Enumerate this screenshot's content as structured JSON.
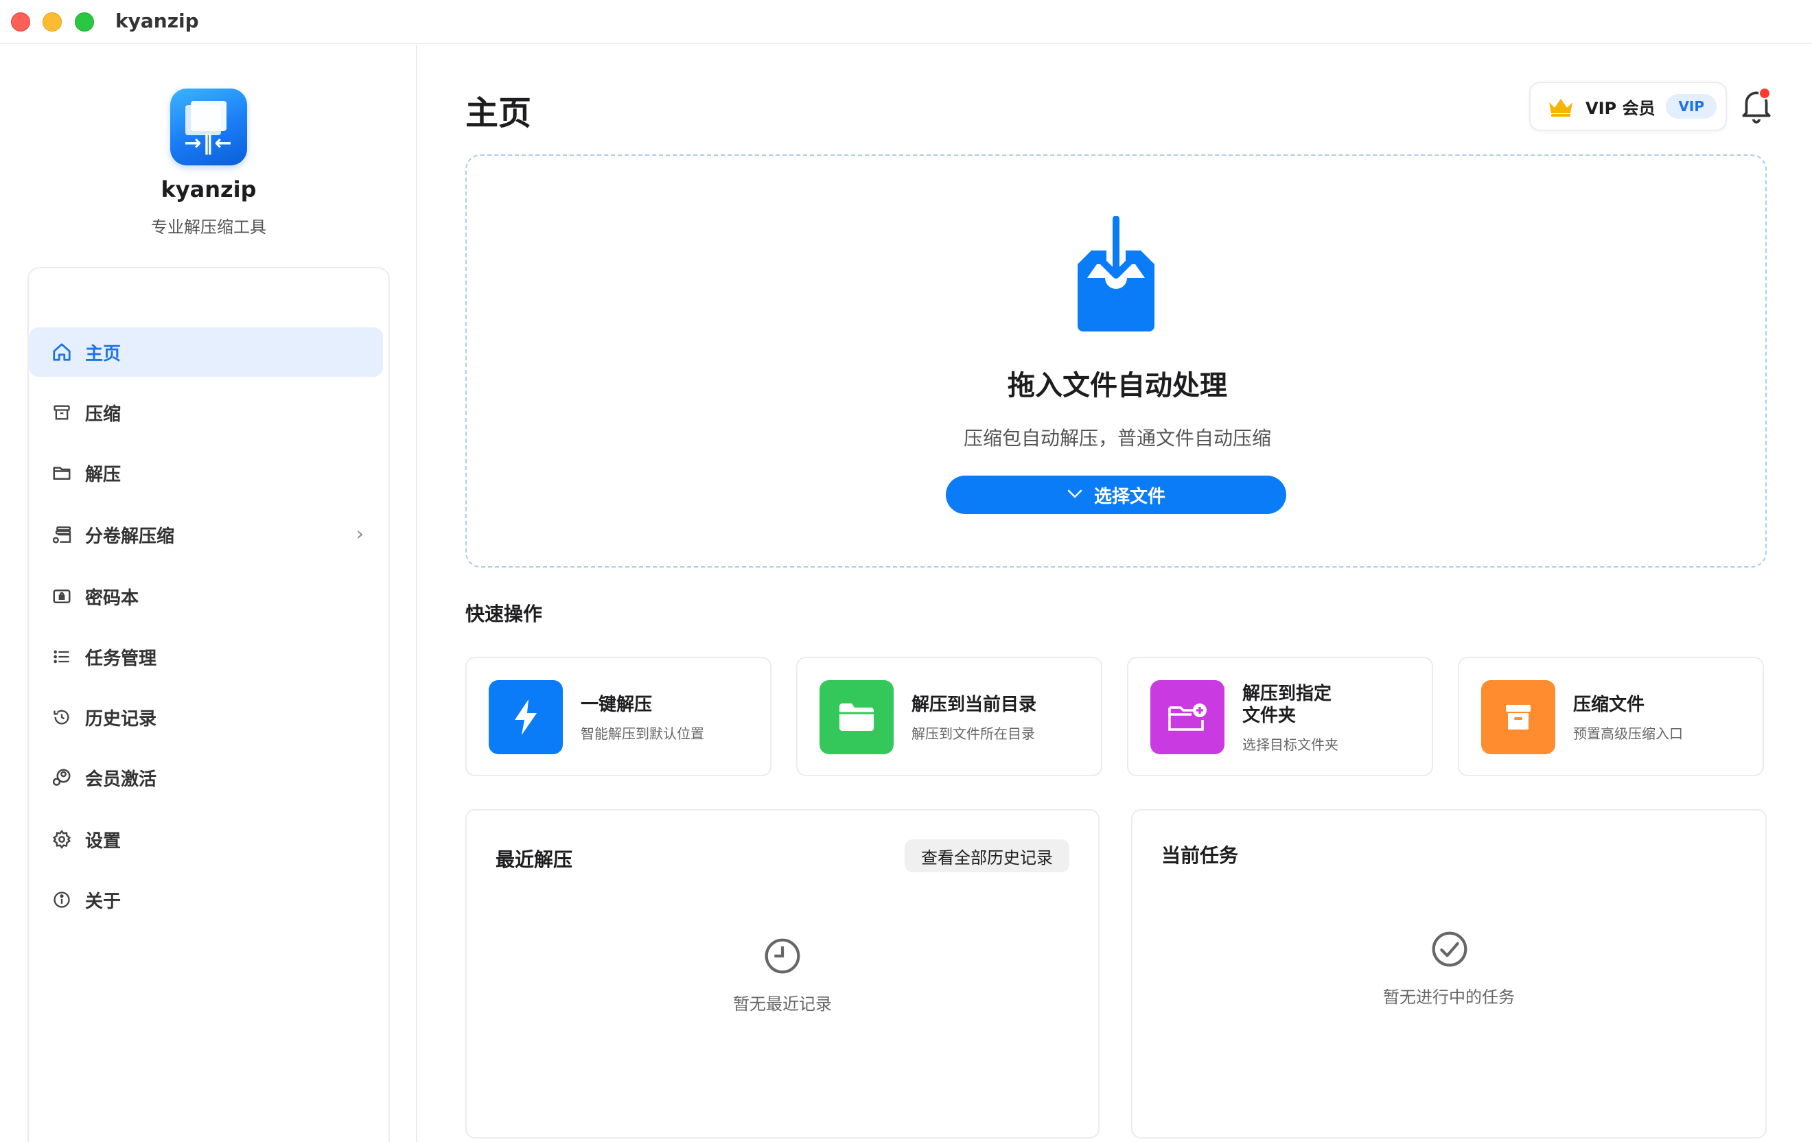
{
  "window": {
    "title": "kyanzip"
  },
  "sidebar": {
    "brand_name": "kyanzip",
    "brand_subtitle": "专业解压缩工具",
    "items": [
      {
        "label": "主页",
        "icon": "home-icon",
        "active": true
      },
      {
        "label": "压缩",
        "icon": "archive-box-icon"
      },
      {
        "label": "解压",
        "icon": "folder-icon"
      },
      {
        "label": "分卷解压缩",
        "icon": "split-volume-icon",
        "chevron": true
      },
      {
        "label": "密码本",
        "icon": "lock-icon"
      },
      {
        "label": "任务管理",
        "icon": "list-icon"
      },
      {
        "label": "历史记录",
        "icon": "history-icon"
      },
      {
        "label": "会员激活",
        "icon": "member-icon"
      },
      {
        "label": "设置",
        "icon": "gear-icon"
      },
      {
        "label": "关于",
        "icon": "info-icon"
      }
    ]
  },
  "header": {
    "page_title": "主页",
    "vip_label": "VIP 会员",
    "vip_badge": "VIP"
  },
  "dropzone": {
    "title": "拖入文件自动处理",
    "subtitle": "压缩包自动解压，普通文件自动压缩",
    "button_label": "选择文件"
  },
  "quick_actions": {
    "title": "快速操作",
    "items": [
      {
        "title": "一键解压",
        "desc": "智能解压到默认位置",
        "color": "#0a7cf7",
        "icon": "lightning-icon"
      },
      {
        "title": "解压到当前目录",
        "desc": "解压到文件所在目录",
        "color": "#34c759",
        "icon": "folder-icon"
      },
      {
        "title_line1": "解压到指定",
        "title_line2": "文件夹",
        "desc": "选择目标文件夹",
        "color": "#c93ae0",
        "icon": "folder-add-icon"
      },
      {
        "title": "压缩文件",
        "desc": "预置高级压缩入口",
        "color": "#ff8c2e",
        "icon": "archive-box-icon"
      }
    ]
  },
  "recent": {
    "title": "最近解压",
    "view_all_label": "查看全部历史记录",
    "empty_text": "暂无最近记录"
  },
  "tasks": {
    "title": "当前任务",
    "empty_text": "暂无进行中的任务"
  },
  "colors": {
    "accent": "#0a7cf7",
    "active_bg": "#e6effd",
    "notification_dot": "#ff3b30"
  }
}
